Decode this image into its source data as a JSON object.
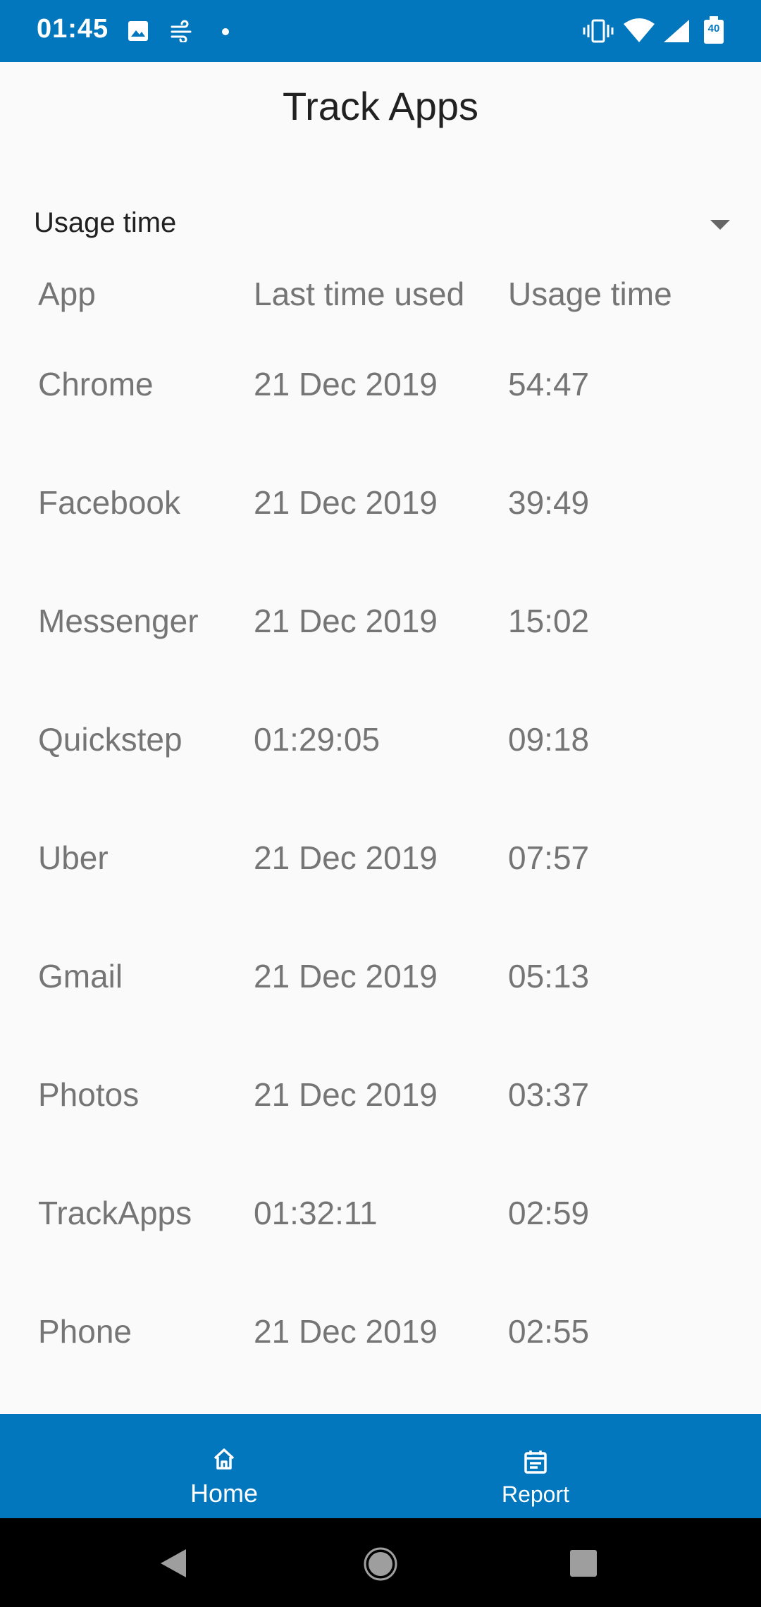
{
  "status_bar": {
    "time": "01:45",
    "battery_level": "40",
    "icons": [
      "image-icon",
      "wind-icon",
      "dot-icon",
      "vibrate-icon",
      "wifi-icon",
      "cell-signal-icon",
      "battery-icon"
    ]
  },
  "header": {
    "title": "Track Apps"
  },
  "sort_dropdown": {
    "selected": "Usage time"
  },
  "table": {
    "columns": [
      "App",
      "Last time used",
      "Usage time"
    ],
    "rows": [
      {
        "app": "Chrome",
        "last_used": "21 Dec 2019",
        "usage": "54:47"
      },
      {
        "app": "Facebook",
        "last_used": "21 Dec 2019",
        "usage": "39:49"
      },
      {
        "app": "Messenger",
        "last_used": "21 Dec 2019",
        "usage": "15:02"
      },
      {
        "app": "Quickstep",
        "last_used": "01:29:05",
        "usage": "09:18"
      },
      {
        "app": "Uber",
        "last_used": "21 Dec 2019",
        "usage": "07:57"
      },
      {
        "app": "Gmail",
        "last_used": "21 Dec 2019",
        "usage": "05:13"
      },
      {
        "app": "Photos",
        "last_used": "21 Dec 2019",
        "usage": "03:37"
      },
      {
        "app": "TrackApps",
        "last_used": "01:32:11",
        "usage": "02:59"
      },
      {
        "app": "Phone",
        "last_used": "21 Dec 2019",
        "usage": "02:55"
      }
    ]
  },
  "bottom_nav": {
    "items": [
      {
        "label": "Home",
        "icon": "home-icon",
        "active": true
      },
      {
        "label": "Report",
        "icon": "calendar-icon",
        "active": false
      }
    ]
  },
  "colors": {
    "primary": "#0277bd",
    "background": "#fafafa",
    "text_muted": "#757575",
    "text_dark": "#212121"
  }
}
